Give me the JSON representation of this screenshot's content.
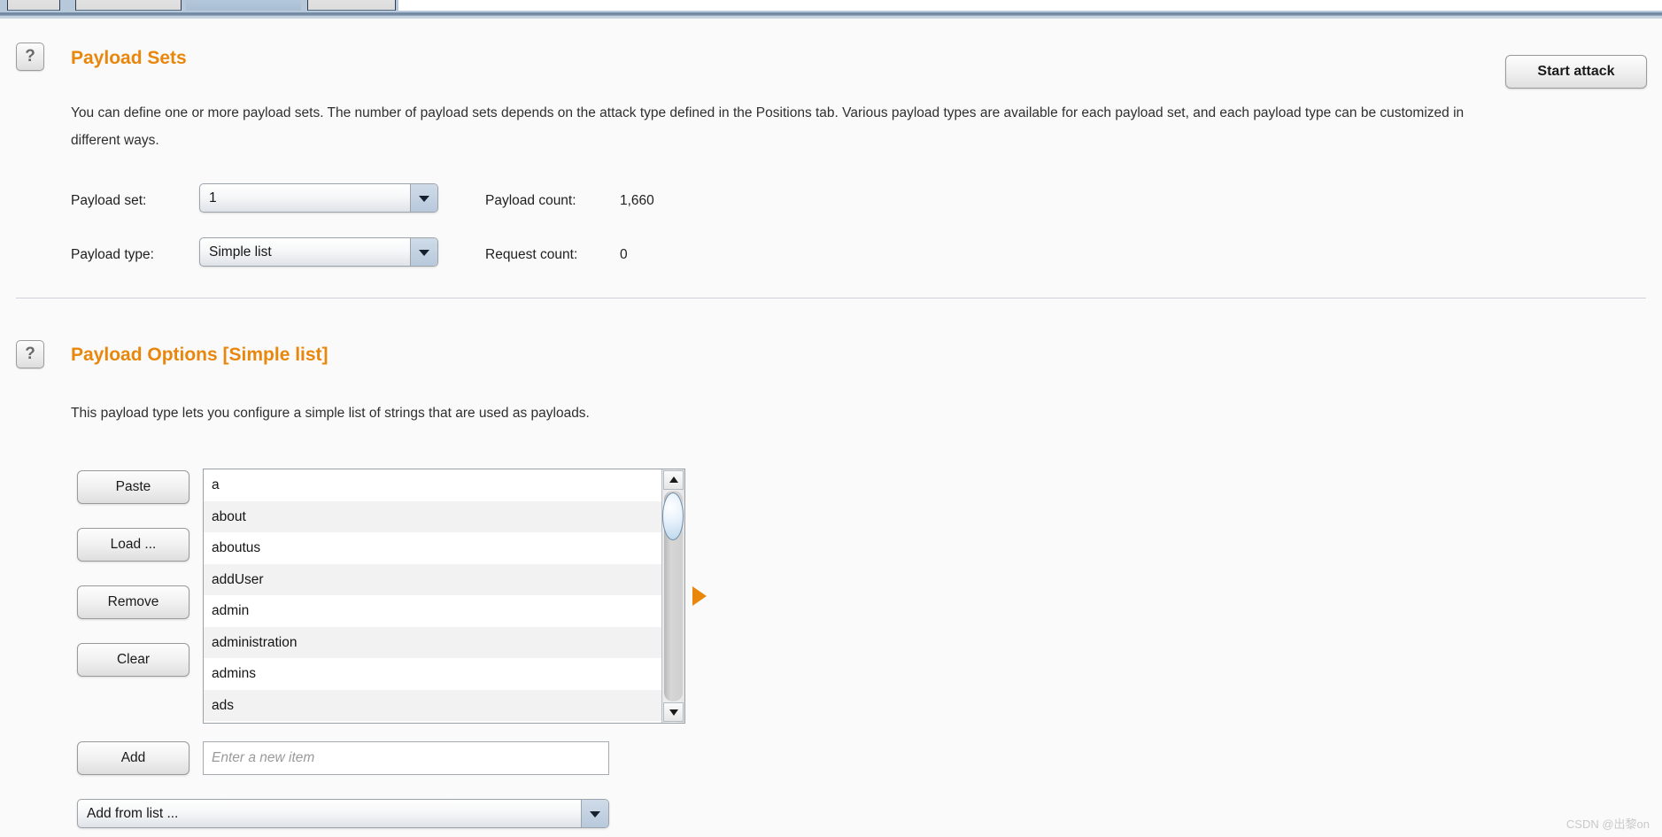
{
  "window": {
    "tabs_visible_hint": "intruder-tab-strip"
  },
  "payload_sets": {
    "help_icon": "question-mark-icon",
    "title": "Payload Sets",
    "description": "You can define one or more payload sets. The number of payload sets depends on the attack type defined in the Positions tab. Various payload types are available for each payload set, and each payload type can be customized in different ways.",
    "payload_set_label": "Payload set:",
    "payload_set_value": "1",
    "payload_type_label": "Payload type:",
    "payload_type_value": "Simple list",
    "payload_count_label": "Payload count:",
    "payload_count_value": "1,660",
    "request_count_label": "Request count:",
    "request_count_value": "0"
  },
  "toolbar": {
    "start_attack_label": "Start attack"
  },
  "payload_options": {
    "help_icon": "question-mark-icon",
    "title": "Payload Options [Simple list]",
    "description": "This payload type lets you configure a simple list of strings that are used as payloads.",
    "buttons": {
      "paste": "Paste",
      "load": "Load ...",
      "remove": "Remove",
      "clear": "Clear",
      "add": "Add"
    },
    "items": [
      "a",
      "about",
      "aboutus",
      "addUser",
      "admin",
      "administration",
      "admins",
      "ads"
    ],
    "new_item_placeholder": "Enter a new item",
    "new_item_value": "",
    "add_from_list_value": "Add from list ...",
    "marker_icon": "play-triangle-icon"
  },
  "watermark": {
    "text": "CSDN @出黎on"
  },
  "colors": {
    "accent_orange": "#e8870c",
    "tab_selected": "#b7c8da",
    "page_background": "#fafafa"
  }
}
